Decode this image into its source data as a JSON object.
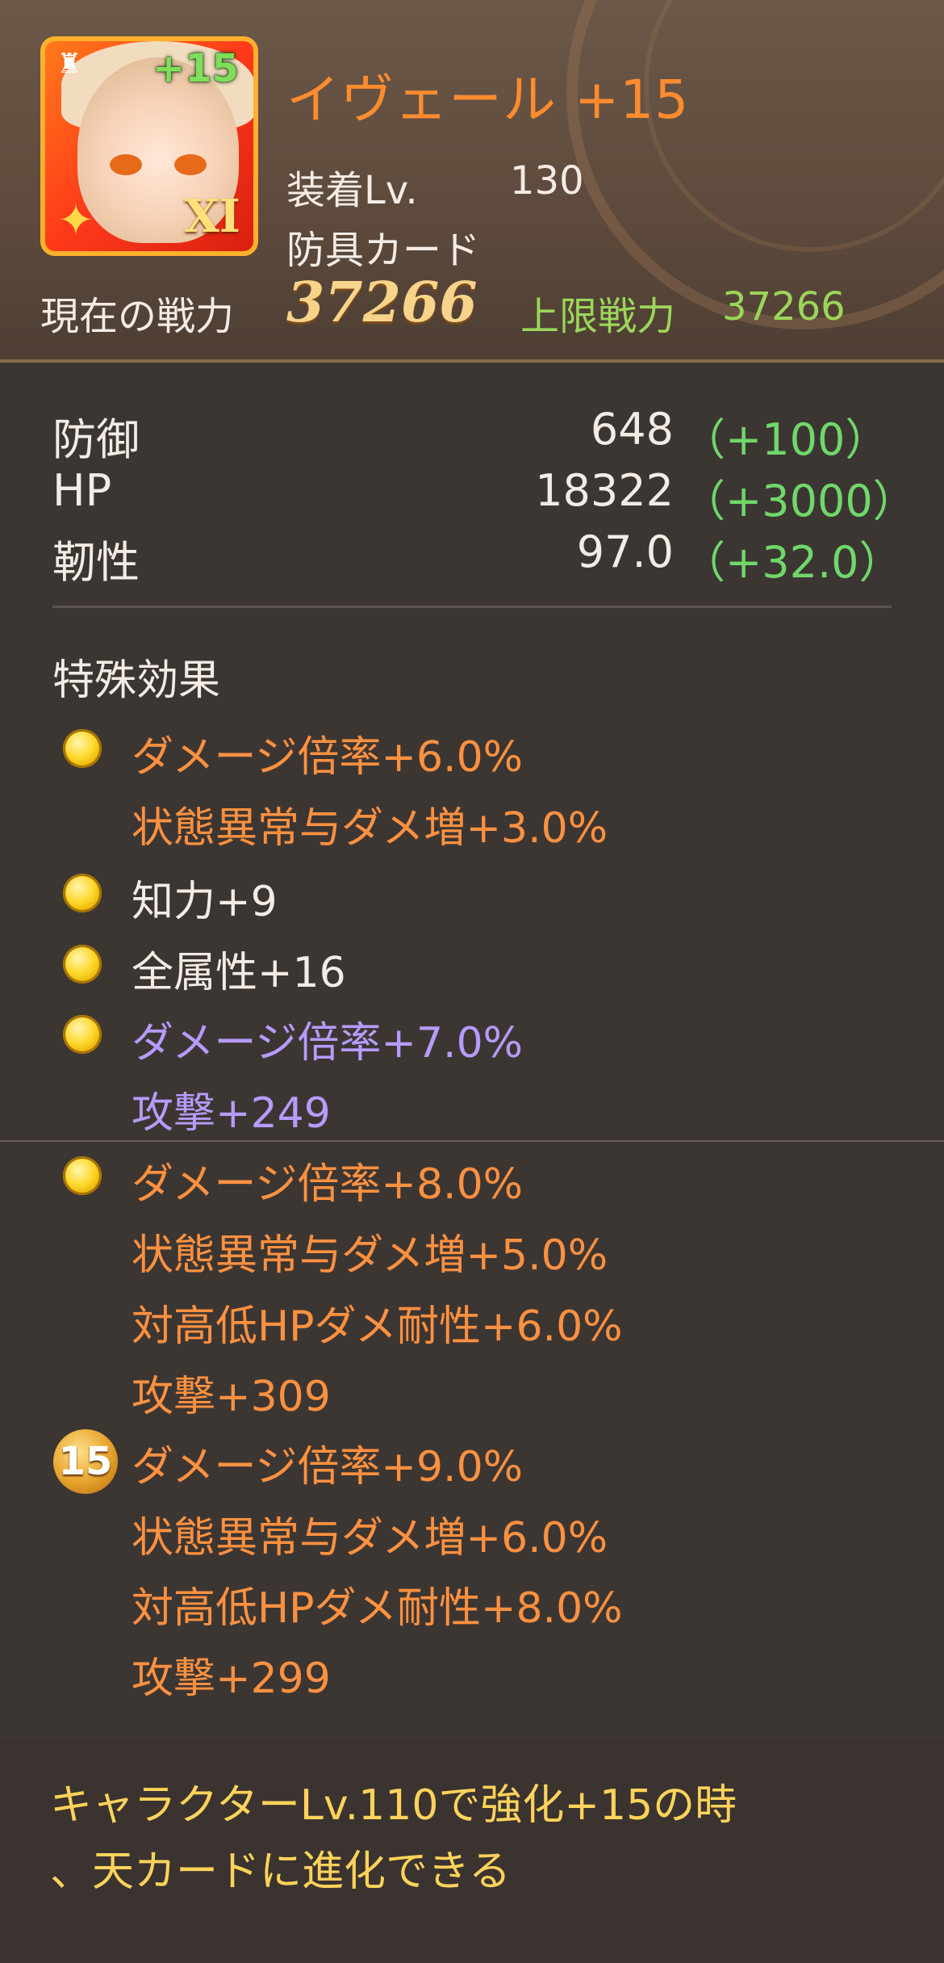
{
  "header": {
    "card_plus": "+15",
    "card_rank": "XI",
    "name": "イヴェール +15",
    "level_label": "装着Lv.",
    "level_value": "130",
    "type": "防具カード",
    "power_label": "現在の戦力",
    "power_value": "37266",
    "max_power_label": "上限戦力",
    "max_power_value": "37266"
  },
  "stats": [
    {
      "label": "防御",
      "value": "648",
      "bonus": "（+100）"
    },
    {
      "label": "HP",
      "value": "18322",
      "bonus": "（+3000）"
    },
    {
      "label": "靭性",
      "value": "97.0",
      "bonus": "（+32.0）"
    }
  ],
  "special": {
    "title": "特殊効果",
    "groups": [
      {
        "lines": [
          "ダメージ倍率+6.0%",
          "状態異常与ダメ増+3.0%"
        ],
        "color": "#ff9140"
      },
      {
        "lines": [
          "知力+9"
        ],
        "color": "#f3ece6"
      },
      {
        "lines": [
          "全属性+16"
        ],
        "color": "#f3ece6"
      },
      {
        "lines": [
          "ダメージ倍率+7.0%",
          "攻撃+249"
        ],
        "color": "#b79bff"
      },
      {
        "lines": [
          "ダメージ倍率+8.0%",
          "状態異常与ダメ増+5.0%",
          "対高低HPダメ耐性+6.0%",
          "攻撃+309"
        ],
        "color": "#ff9140"
      },
      {
        "badge": "15",
        "lines": [
          "ダメージ倍率+9.0%",
          "状態異常与ダメ増+6.0%",
          "対高低HPダメ耐性+8.0%",
          "攻撃+299"
        ],
        "color": "#ff9140"
      }
    ]
  },
  "footer": {
    "line1": "キャラクターLv.110で強化+15の時",
    "line2": "、天カードに進化できる"
  }
}
